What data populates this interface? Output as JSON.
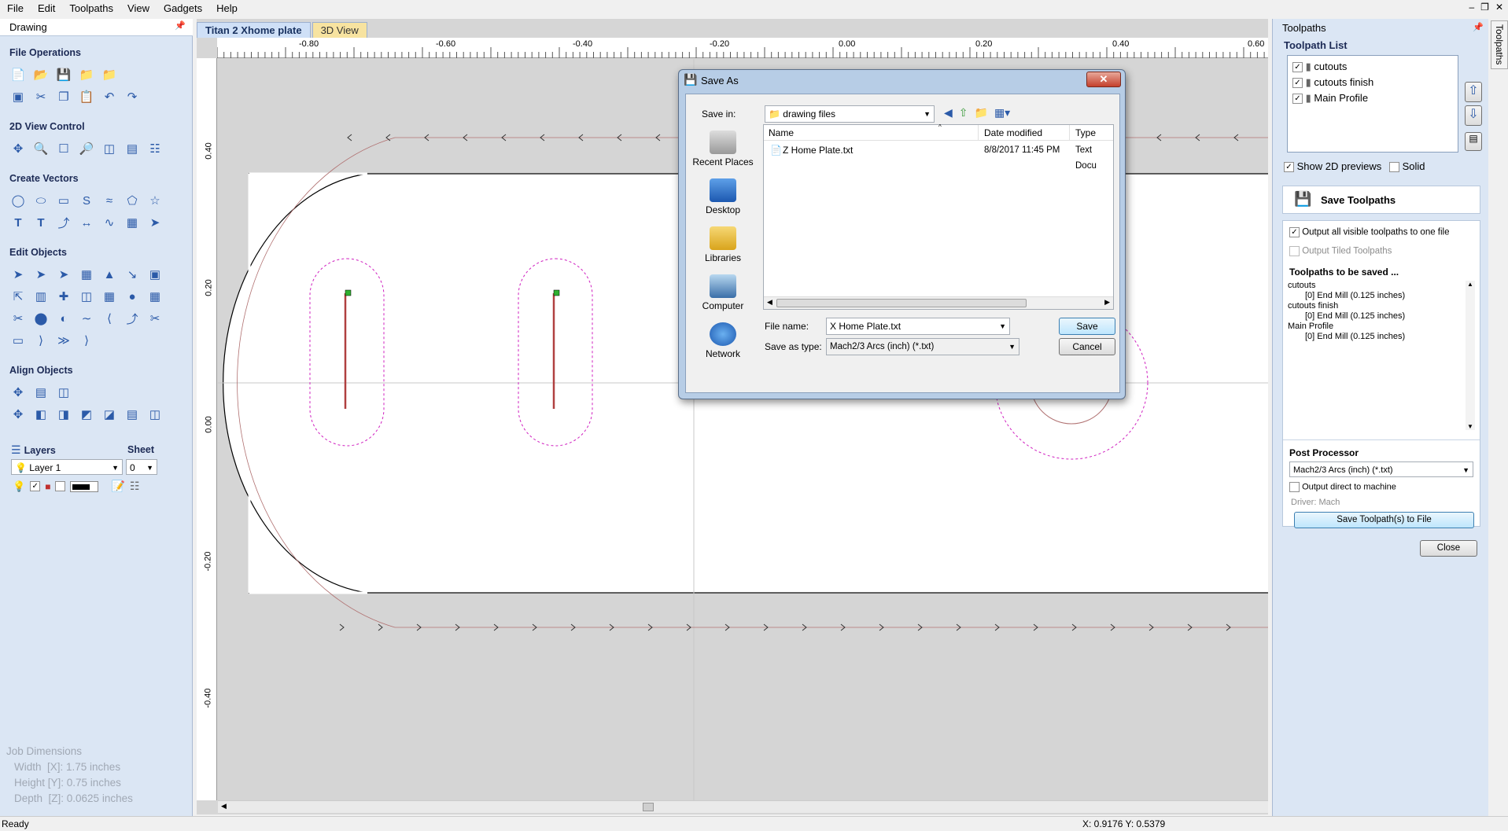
{
  "menu": [
    "File",
    "Edit",
    "Toolpaths",
    "View",
    "Gadgets",
    "Help"
  ],
  "window_controls": [
    "minimize-icon",
    "restore-icon",
    "close-icon"
  ],
  "left_panel": {
    "title": "Drawing",
    "sections": {
      "file_ops": "File Operations",
      "view_control": "2D View Control",
      "create_vectors": "Create Vectors",
      "edit_objects": "Edit Objects",
      "align_objects": "Align Objects"
    },
    "layers_label": "Layers",
    "sheet_label": "Sheet",
    "layer_value": "Layer 1",
    "sheet_value": "0",
    "job_dimensions": {
      "title": "Job Dimensions",
      "width": "Width  [X]: 1.75 inches",
      "height": "Height [Y]: 0.75 inches",
      "depth": "Depth  [Z]: 0.0625 inches"
    }
  },
  "tabs": [
    {
      "label": "Titan 2 Xhome plate",
      "active": true
    },
    {
      "label": "3D View",
      "active": false
    }
  ],
  "ruler": {
    "top_labels": [
      "-0.80",
      "-0.60",
      "-0.40",
      "-0.20",
      "0.00",
      "0.20",
      "0.40",
      "0.60"
    ],
    "left_labels": [
      "0.40",
      "0.20",
      "0.00",
      "-0.20",
      "-0.40"
    ]
  },
  "dialog": {
    "title": "Save As",
    "save_in_label": "Save in:",
    "save_in_value": "drawing files",
    "places": [
      "Recent Places",
      "Desktop",
      "Libraries",
      "Computer",
      "Network"
    ],
    "columns": [
      "Name",
      "Date modified",
      "Type"
    ],
    "files": [
      {
        "name": "Z Home Plate.txt",
        "date": "8/8/2017 11:45 PM",
        "type": "Text Docu"
      }
    ],
    "file_name_label": "File name:",
    "file_name_value": "X Home Plate.txt",
    "save_as_type_label": "Save as type:",
    "save_as_type_value": "Mach2/3 Arcs (inch) (*.txt)",
    "save_button": "Save",
    "cancel_button": "Cancel"
  },
  "right_panel": {
    "title": "Toolpaths",
    "vertical_tab": "Toolpaths",
    "list_title": "Toolpath List",
    "toolpaths": [
      "cutouts",
      "cutouts finish",
      "Main Profile"
    ],
    "show_previews": "Show 2D previews",
    "solid": "Solid",
    "save_toolpaths_title": "Save Toolpaths",
    "output_all": "Output all visible toolpaths to one file",
    "output_tiled": "Output Tiled Toolpaths",
    "to_be_saved_title": "Toolpaths to be saved ...",
    "saved_lines": [
      {
        "text": "cutouts",
        "indent": false
      },
      {
        "text": "[0] End Mill (0.125 inches)",
        "indent": true
      },
      {
        "text": "cutouts finish",
        "indent": false
      },
      {
        "text": "[0] End Mill (0.125 inches)",
        "indent": true
      },
      {
        "text": "Main Profile",
        "indent": false
      },
      {
        "text": "[0] End Mill (0.125 inches)",
        "indent": true
      }
    ],
    "post_processor_label": "Post Processor",
    "post_processor_value": "Mach2/3 Arcs (inch) (*.txt)",
    "output_direct": "Output direct to machine",
    "driver": "Driver: Mach",
    "save_to_file_button": "Save Toolpath(s) to File",
    "close_button": "Close"
  },
  "status": {
    "left": "Ready",
    "coords": "X: 0.9176 Y: 0.5379"
  }
}
